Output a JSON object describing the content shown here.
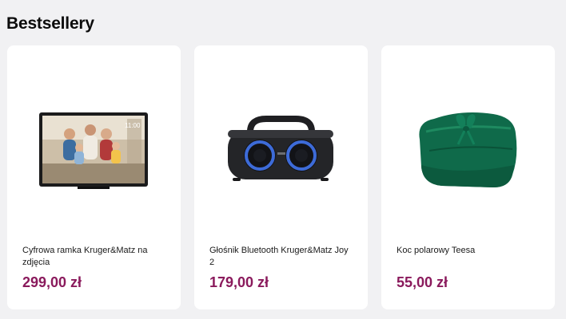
{
  "section": {
    "title": "Bestsellery"
  },
  "products": [
    {
      "name": "Cyfrowa ramka Kruger&Matz na zdjęcia",
      "price": "299,00 zł",
      "image_icon": "digital-photo-frame",
      "screen_time": "11:00"
    },
    {
      "name": "Głośnik Bluetooth Kruger&Matz Joy 2",
      "price": "179,00 zł",
      "image_icon": "bluetooth-speaker"
    },
    {
      "name": "Koc polarowy Teesa",
      "price": "55,00 zł",
      "image_icon": "fleece-blanket"
    }
  ],
  "colors": {
    "price": "#8a1a5c",
    "background": "#f1f1f3",
    "card": "#ffffff"
  }
}
